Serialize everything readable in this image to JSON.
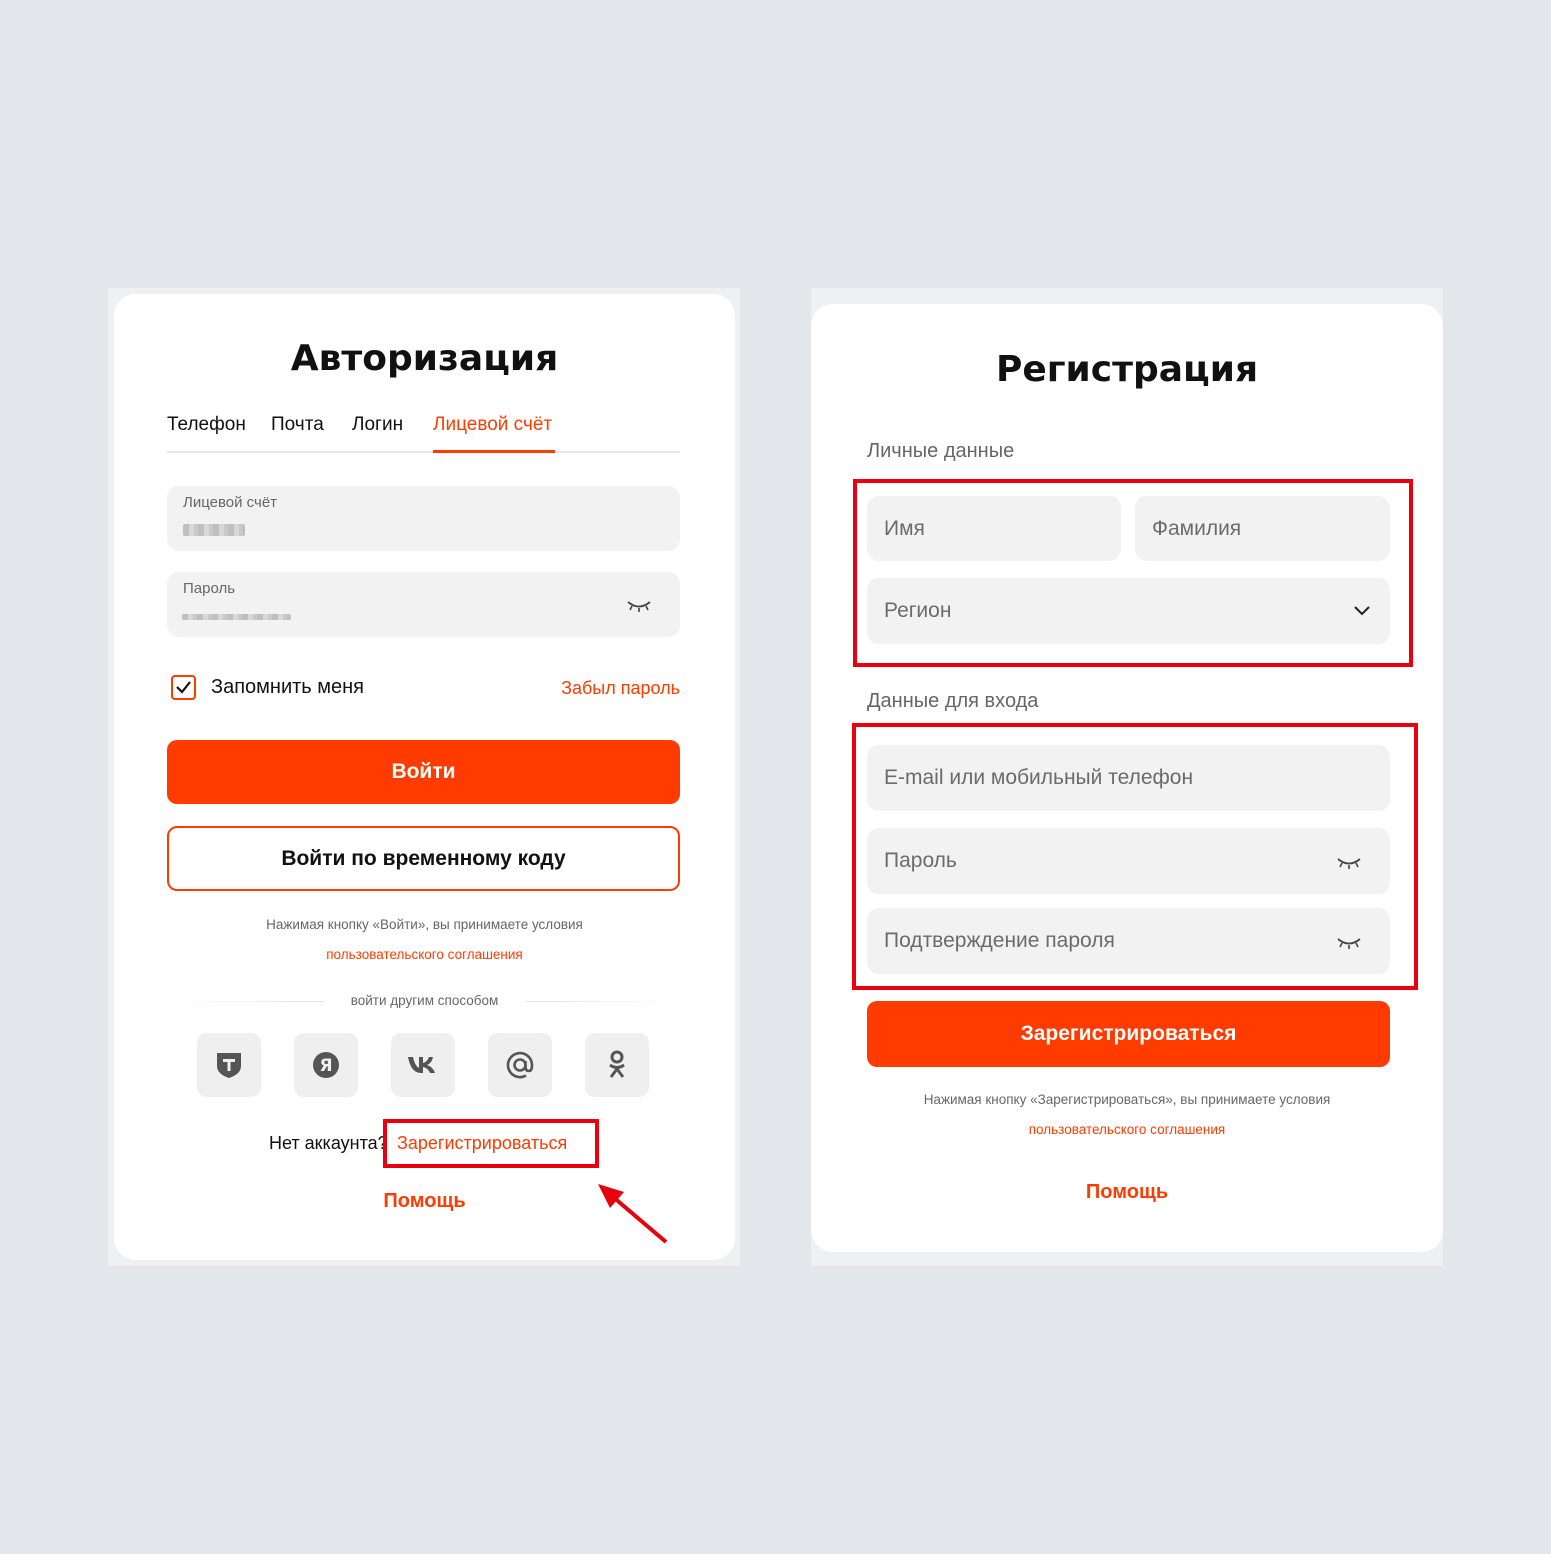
{
  "login": {
    "title": "Авторизация",
    "tabs": [
      {
        "label": "Телефон",
        "active": false
      },
      {
        "label": "Почта",
        "active": false
      },
      {
        "label": "Логин",
        "active": false
      },
      {
        "label": "Лицевой счёт",
        "active": true
      }
    ],
    "account_field": {
      "label": "Лицевой счёт"
    },
    "password_field": {
      "label": "Пароль"
    },
    "remember_label": "Запомнить меня",
    "remember_checked": true,
    "forgot_password": "Забыл пароль",
    "login_button": "Войти",
    "temp_code_button": "Войти по временному коду",
    "terms_text": "Нажимая кнопку «Войти», вы принимаете условия",
    "terms_link": "пользовательского соглашения",
    "divider_text": "войти другим способом",
    "social_icons": [
      "t-bank-icon",
      "yandex-icon",
      "vk-icon",
      "mail-at-icon",
      "odnoklassniki-icon"
    ],
    "no_account_text": "Нет аккаунта?",
    "register_link": "Зарегистрироваться",
    "help_link": "Помощь"
  },
  "registration": {
    "title": "Регистрация",
    "personal_section": "Личные данные",
    "first_name_placeholder": "Имя",
    "last_name_placeholder": "Фамилия",
    "region_placeholder": "Регион",
    "login_section": "Данные для входа",
    "email_placeholder": "E-mail или мобильный телефон",
    "password_placeholder": "Пароль",
    "confirm_placeholder": "Подтверждение пароля",
    "register_button": "Зарегистрироваться",
    "terms_text": "Нажимая кнопку «Зарегистрироваться», вы принимаете условия",
    "terms_link": "пользовательского соглашения",
    "help_link": "Помощь"
  },
  "colors": {
    "accent": "#ff3b00",
    "highlight": "#e8000f",
    "background": "#e3e7eb"
  }
}
